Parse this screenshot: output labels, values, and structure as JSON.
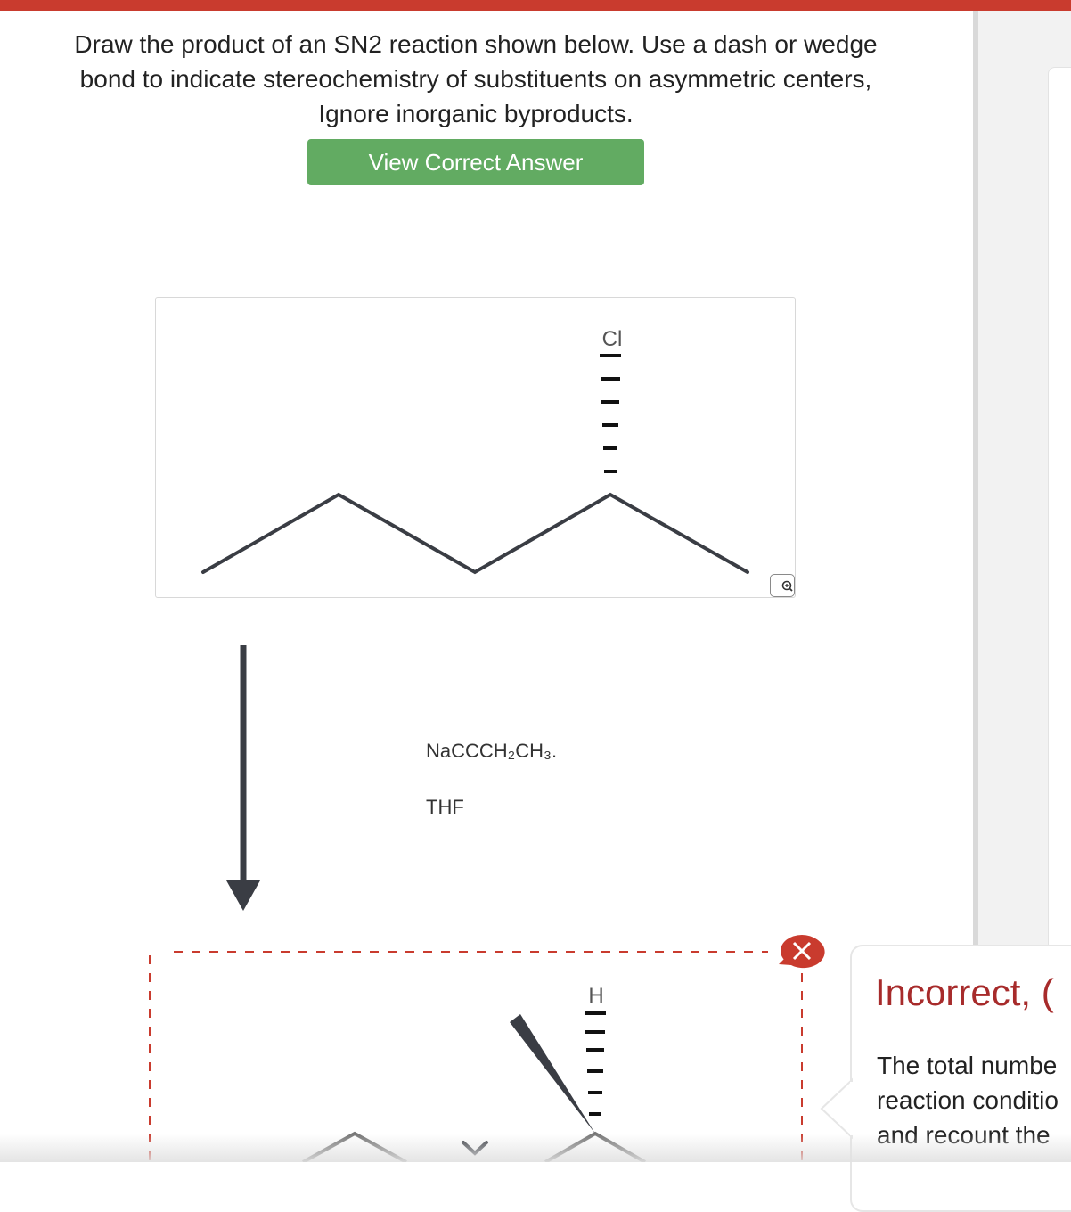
{
  "question": {
    "line1": "Draw the product of an SN2 reaction shown below. Use a dash or wedge",
    "line2": "bond to indicate stereochemistry of substituents on asymmetric centers,",
    "line3": "Ignore inorganic byproducts."
  },
  "answer_button": {
    "label": "View Correct Answer"
  },
  "reactant": {
    "substituent_label": "Cl"
  },
  "reagents": {
    "reagent_1": "NaCCCH₂CH₃.",
    "reagent_2": "THF"
  },
  "answer_area": {
    "substituent_label": "H"
  },
  "feedback": {
    "title": "Incorrect, (",
    "line1": "The total numbe",
    "line2": "reaction conditio",
    "line3": "and recount the"
  },
  "icons": {
    "zoom": "magnifier-zoom-icon",
    "close": "close-x-icon",
    "reaction_arrow": "down-arrow-icon"
  },
  "colors": {
    "topbar": "#c93b2e",
    "button": "#62ab62",
    "error": "#a72b2b",
    "bond": "#3a3d44"
  }
}
